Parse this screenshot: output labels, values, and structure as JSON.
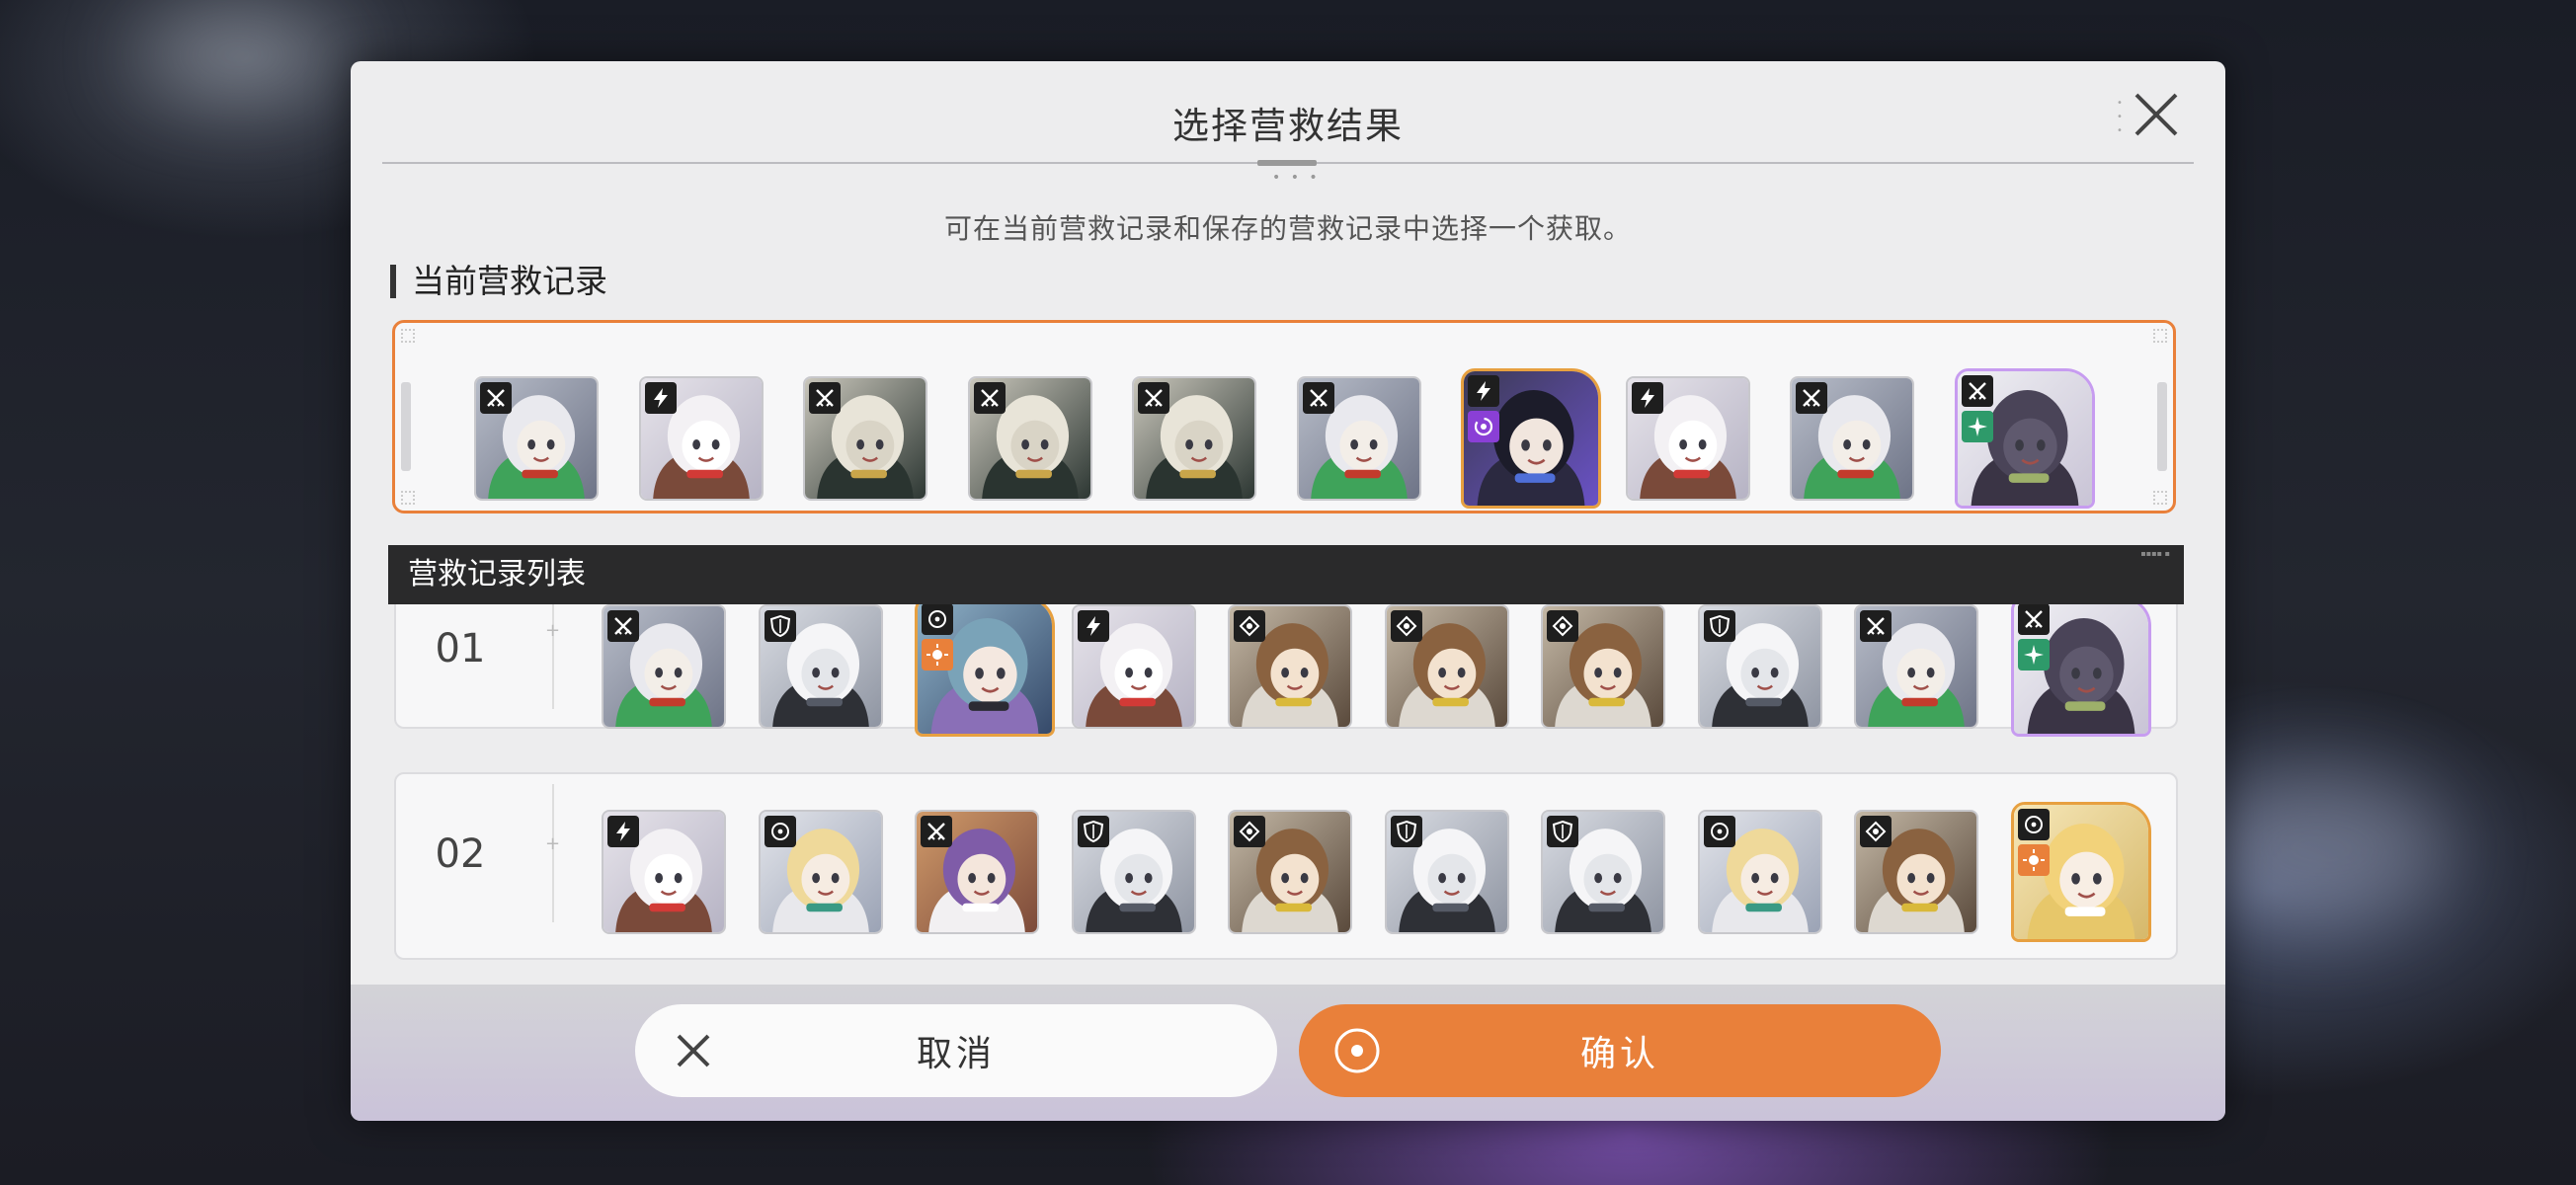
{
  "dialog": {
    "title": "选择营救结果",
    "subtitle": "可在当前营救记录和保存的营救记录中选择一个获取。"
  },
  "current": {
    "heading": "当前营救记录",
    "cards": [
      {
        "icon": "sword-cross-icon",
        "face": "white-hair-girl",
        "frame": "normal"
      },
      {
        "icon": "lightning-icon",
        "face": "white-fox-mask",
        "frame": "normal"
      },
      {
        "icon": "sword-cross-icon",
        "face": "armored-beast",
        "frame": "normal"
      },
      {
        "icon": "sword-cross-icon",
        "face": "armored-beast",
        "frame": "normal"
      },
      {
        "icon": "sword-cross-icon",
        "face": "armored-beast",
        "frame": "normal"
      },
      {
        "icon": "sword-cross-icon",
        "face": "white-hair-girl",
        "frame": "normal"
      },
      {
        "icon": "lightning-icon",
        "elem": "purple-swirl-icon",
        "face": "dark-hair-girl",
        "frame": "gold"
      },
      {
        "icon": "lightning-icon",
        "face": "white-fox-mask",
        "frame": "normal"
      },
      {
        "icon": "sword-cross-icon",
        "face": "white-hair-girl",
        "frame": "normal"
      },
      {
        "icon": "sword-cross-icon",
        "elem": "green-star-icon",
        "face": "dark-wolf",
        "frame": "rainbow"
      }
    ]
  },
  "list": {
    "heading": "营救记录列表",
    "records": [
      {
        "num": "01",
        "cards": [
          {
            "icon": "sword-cross-icon",
            "face": "white-hair-girl",
            "frame": "normal"
          },
          {
            "icon": "shield-icon",
            "face": "white-beast",
            "frame": "normal"
          },
          {
            "icon": "target-icon",
            "elem": "orange-sun-icon",
            "face": "headphone-girl",
            "frame": "gold"
          },
          {
            "icon": "lightning-icon",
            "face": "white-fox-mask",
            "frame": "normal"
          },
          {
            "icon": "crosshair-icon",
            "face": "brown-hair-girl",
            "frame": "normal"
          },
          {
            "icon": "crosshair-icon",
            "face": "brown-hair-girl",
            "frame": "normal"
          },
          {
            "icon": "crosshair-icon",
            "face": "brown-hair-girl",
            "frame": "normal"
          },
          {
            "icon": "shield-icon",
            "face": "white-beast",
            "frame": "normal"
          },
          {
            "icon": "sword-cross-icon",
            "face": "white-hair-girl",
            "frame": "normal"
          },
          {
            "icon": "sword-cross-icon",
            "elem": "green-star-icon",
            "face": "dark-wolf",
            "frame": "rainbow"
          }
        ]
      },
      {
        "num": "02",
        "cards": [
          {
            "icon": "lightning-icon",
            "face": "white-fox-mask",
            "frame": "normal"
          },
          {
            "icon": "target-icon",
            "face": "blonde-girl",
            "frame": "normal"
          },
          {
            "icon": "sword-cross-icon",
            "face": "purple-hair-girl",
            "frame": "normal"
          },
          {
            "icon": "shield-icon",
            "face": "white-beast",
            "frame": "normal"
          },
          {
            "icon": "crosshair-icon",
            "face": "brown-hair-girl",
            "frame": "normal"
          },
          {
            "icon": "shield-icon",
            "face": "white-beast",
            "frame": "normal"
          },
          {
            "icon": "shield-icon",
            "face": "white-beast",
            "frame": "normal"
          },
          {
            "icon": "target-icon",
            "face": "blonde-girl",
            "frame": "normal"
          },
          {
            "icon": "crosshair-icon",
            "face": "brown-hair-girl",
            "frame": "normal"
          },
          {
            "icon": "target-icon",
            "elem": "orange-sun-icon",
            "face": "blonde-long-hair",
            "frame": "gold"
          }
        ]
      }
    ]
  },
  "buttons": {
    "cancel": "取消",
    "confirm": "确认"
  },
  "colors": {
    "accent": "#e9803a",
    "dialog_bg": "#ededee",
    "list_header_bg": "#2a2a2b"
  }
}
